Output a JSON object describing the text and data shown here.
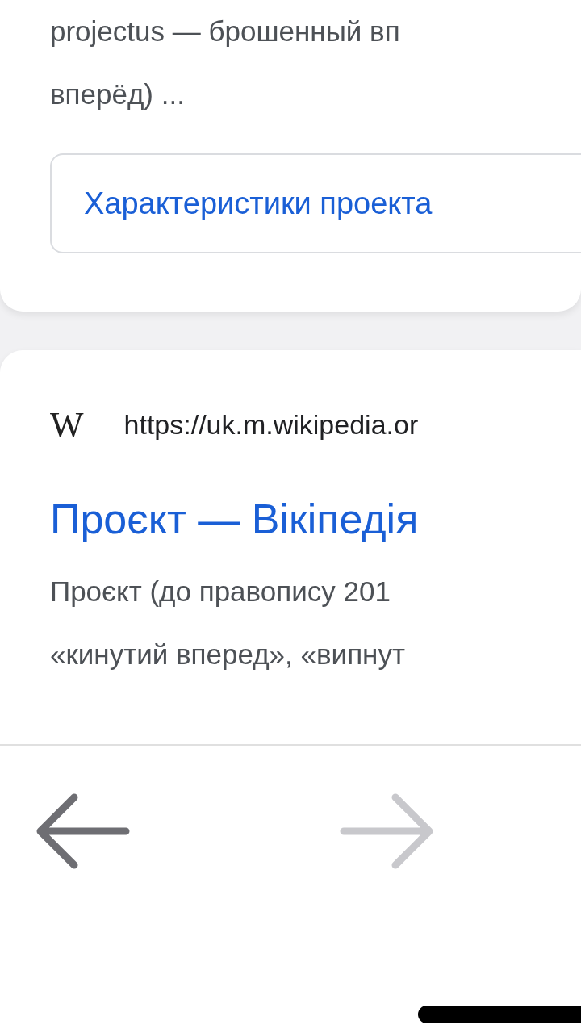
{
  "results": [
    {
      "kind": "snippet",
      "snippet_lines": [
        "projectus — брошенный вп",
        "вперёд) ..."
      ],
      "chips": [
        "Характеристики проекта"
      ]
    },
    {
      "kind": "result",
      "favicon": "W",
      "url": "https://uk.m.wikipedia.or",
      "title": "Проєкт — Вікіпедія",
      "snippet_lines": [
        "Проєкт (до правопису 201",
        "«кинутий вперед», «випнут"
      ]
    }
  ],
  "toolbar": {
    "back": {
      "disabled": false
    },
    "forward": {
      "disabled": true
    }
  }
}
